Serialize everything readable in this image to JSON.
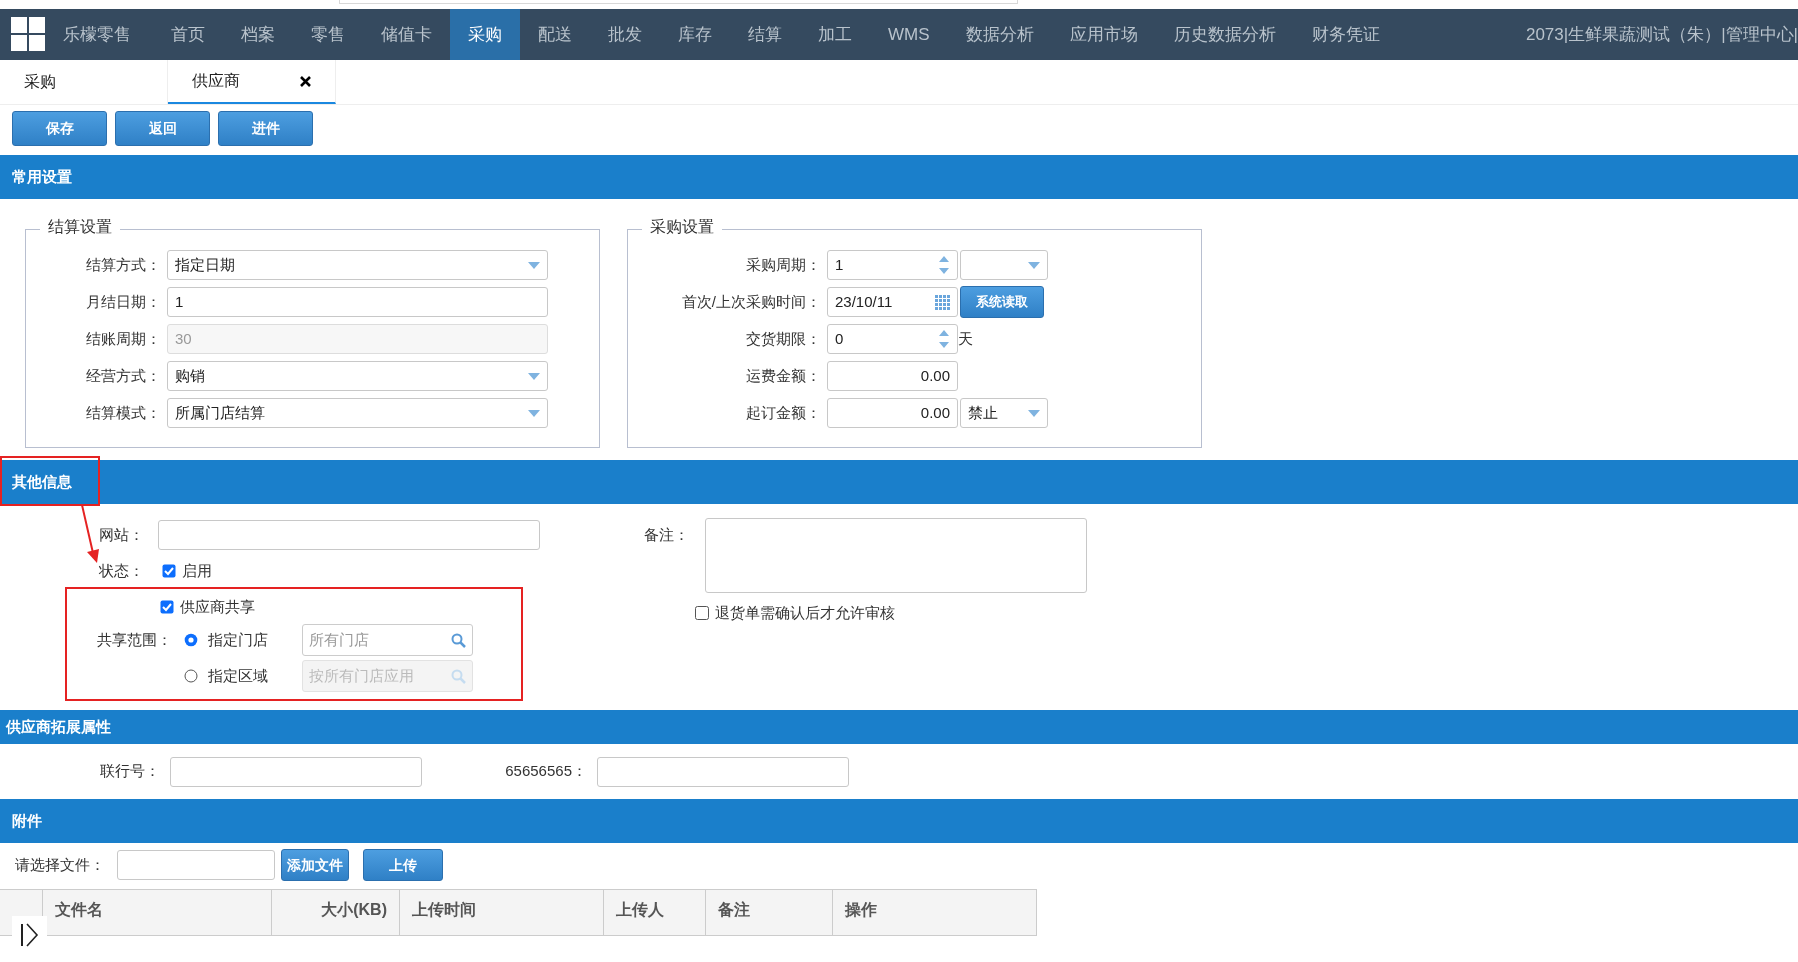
{
  "app_menu": {
    "brand": "乐檬零售",
    "items": [
      {
        "label": "首页",
        "selected": false
      },
      {
        "label": "档案",
        "selected": false
      },
      {
        "label": "零售",
        "selected": false
      },
      {
        "label": "储值卡",
        "selected": false
      },
      {
        "label": "采购",
        "selected": true
      },
      {
        "label": "配送",
        "selected": false
      },
      {
        "label": "批发",
        "selected": false
      },
      {
        "label": "库存",
        "selected": false
      },
      {
        "label": "结算",
        "selected": false
      },
      {
        "label": "加工",
        "selected": false
      },
      {
        "label": "WMS",
        "selected": false
      },
      {
        "label": "数据分析",
        "selected": false
      },
      {
        "label": "应用市场",
        "selected": false
      },
      {
        "label": "历史数据分析",
        "selected": false
      },
      {
        "label": "财务凭证",
        "selected": false
      }
    ],
    "user_info": "2073|生鲜果蔬测试（朱）|管理中心|"
  },
  "page_tabs": [
    {
      "label": "采购",
      "selected": false,
      "closable": false
    },
    {
      "label": "供应商",
      "selected": true,
      "closable": true
    }
  ],
  "toolbar": [
    "保存",
    "返回",
    "进件"
  ],
  "common_settings": {
    "title": "常用设置",
    "groups": [
      {
        "legend": "结算设置",
        "fields": [
          {
            "label": "结算方式：",
            "kind": "select",
            "value": "指定日期"
          },
          {
            "label": "月结日期：",
            "kind": "text",
            "value": "1"
          },
          {
            "label": "结账周期：",
            "kind": "text",
            "value": "30",
            "disabled": true
          },
          {
            "label": "经营方式：",
            "kind": "select",
            "value": "购销"
          },
          {
            "label": "结算模式：",
            "kind": "select",
            "value": "所属门店结算"
          }
        ]
      },
      {
        "legend": "采购设置",
        "fields": [
          {
            "label": "采购周期：",
            "kind": "spinner",
            "value": "1",
            "extra": {
              "kind": "select"
            }
          },
          {
            "label": "首次/上次采购时间：",
            "kind": "date",
            "value": "23/10/11",
            "extra": {
              "kind": "button",
              "label": "系统读取"
            }
          },
          {
            "label": "交货期限：",
            "kind": "spinner",
            "value": "0",
            "extra": {
              "kind": "suffix",
              "label": "天"
            }
          },
          {
            "label": "运费金额：",
            "kind": "number",
            "value": "0.00"
          },
          {
            "label": "起订金额：",
            "kind": "number",
            "value": "0.00",
            "extra": {
              "kind": "select",
              "value": "禁止"
            }
          }
        ]
      }
    ]
  },
  "other_info": {
    "title": "其他信息",
    "website": {
      "label": "网站："
    },
    "status": {
      "label": "状态：",
      "option": "启用",
      "checked": true
    },
    "share": {
      "label": "供应商共享",
      "checked": true
    },
    "share_scope": {
      "label": "共享范围：",
      "options": [
        {
          "label": "指定门店",
          "selected": true,
          "placeholder": "所有门店",
          "disabled": false
        },
        {
          "label": "指定区域",
          "selected": false,
          "placeholder": "按所有门店应用",
          "disabled": true
        }
      ]
    },
    "remark": {
      "label": "备注："
    },
    "return_confirm": {
      "label": "退货单需确认后才允许审核",
      "checked": false
    }
  },
  "extended": {
    "title": "供应商拓展属性",
    "fields": [
      {
        "label": "联行号："
      },
      {
        "label": "65656565："
      }
    ]
  },
  "attachments": {
    "title": "附件",
    "file_label": "请选择文件：",
    "buttons": [
      "添加文件",
      "上传"
    ],
    "columns": [
      "文件名",
      "大小(KB)",
      "上传时间",
      "上传人",
      "备注",
      "操作"
    ]
  }
}
